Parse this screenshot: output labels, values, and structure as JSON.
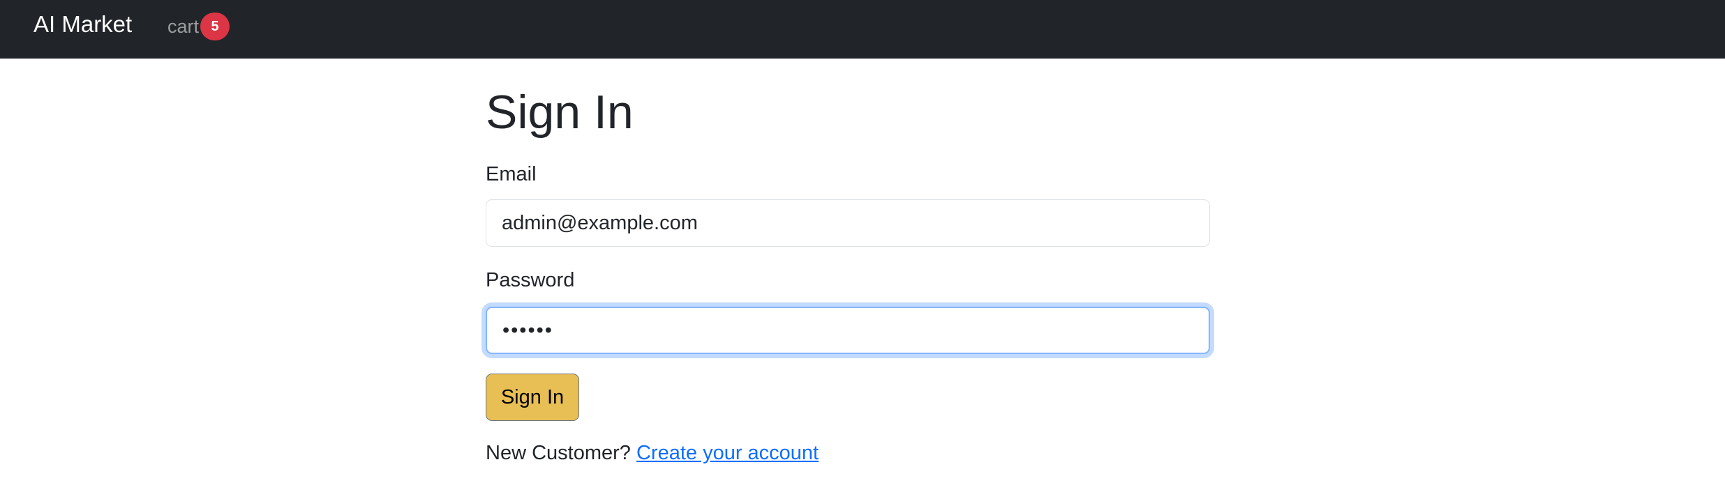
{
  "navbar": {
    "brand": "AI Market",
    "cart_label": "cart",
    "cart_count": "5"
  },
  "main": {
    "title": "Sign In",
    "email_label": "Email",
    "email_value": "admin@example.com",
    "password_label": "Password",
    "password_value": "••••••",
    "submit_label": "Sign In",
    "new_customer_text": "New Customer?",
    "create_account_link": "Create your account"
  },
  "colors": {
    "navbar_bg": "#212529",
    "badge_bg": "#dc3545",
    "button_bg": "#e8bf55",
    "link": "#0d6efd",
    "focus_ring": "#86b7fe"
  }
}
